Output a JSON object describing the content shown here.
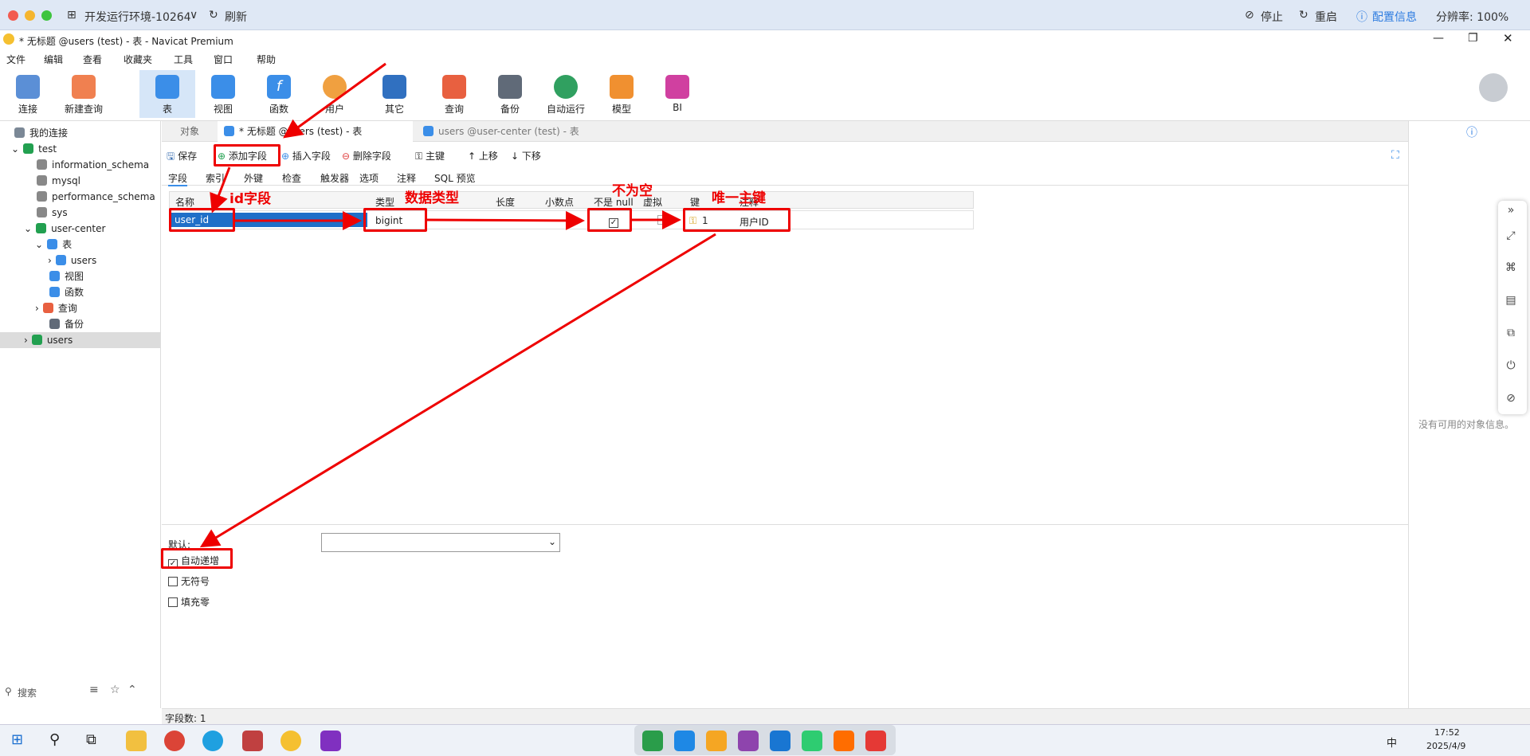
{
  "remote": {
    "env": "开发运行环境-10264",
    "refresh": "刷新",
    "stop": "停止",
    "restart": "重启",
    "config": "配置信息",
    "resolution": "分辨率: 100%"
  },
  "window": {
    "title": "* 无标题 @users (test) - 表 - Navicat Premium"
  },
  "menu": [
    "文件",
    "编辑",
    "查看",
    "收藏夹",
    "工具",
    "窗口",
    "帮助"
  ],
  "toolbar": [
    {
      "label": "连接",
      "color": "#5b8fd6"
    },
    {
      "label": "新建查询",
      "color": "#f08050"
    },
    {
      "label": "表",
      "color": "#3b8ee8"
    },
    {
      "label": "视图",
      "color": "#3b8ee8"
    },
    {
      "label": "函数",
      "color": "#3b8ee8"
    },
    {
      "label": "用户",
      "color": "#f0a040"
    },
    {
      "label": "其它",
      "color": "#3070c0"
    },
    {
      "label": "查询",
      "color": "#e86040"
    },
    {
      "label": "备份",
      "color": "#606a78"
    },
    {
      "label": "自动运行",
      "color": "#30a060"
    },
    {
      "label": "模型",
      "color": "#f09030"
    },
    {
      "label": "BI",
      "color": "#d040a0"
    }
  ],
  "sidebar": {
    "header": "我的连接",
    "items": [
      {
        "label": "test",
        "color": "#22a050"
      },
      {
        "label": "information_schema",
        "color": "#888"
      },
      {
        "label": "mysql",
        "color": "#888"
      },
      {
        "label": "performance_schema",
        "color": "#888"
      },
      {
        "label": "sys",
        "color": "#888"
      },
      {
        "label": "user-center",
        "color": "#22a050"
      },
      {
        "label": "表",
        "color": "#3b8ee8"
      },
      {
        "label": "users",
        "color": "#3b8ee8"
      },
      {
        "label": "视图",
        "color": "#3b8ee8"
      },
      {
        "label": "函数",
        "color": "#3b8ee8"
      },
      {
        "label": "查询",
        "color": "#e86040"
      },
      {
        "label": "备份",
        "color": "#606a78"
      },
      {
        "label": "users",
        "color": "#22a050"
      }
    ],
    "search_placeholder": "搜索"
  },
  "tabs": {
    "objects": "对象",
    "active": "* 无标题 @users (test) - 表",
    "other": "users @user-center (test) - 表"
  },
  "design_toolbar": {
    "save": "保存",
    "add_field": "添加字段",
    "insert_field": "插入字段",
    "delete_field": "删除字段",
    "primary_key": "主键",
    "move_up": "上移",
    "move_down": "下移"
  },
  "subtabs": [
    "字段",
    "索引",
    "外键",
    "检查",
    "触发器",
    "选项",
    "注释",
    "SQL 预览"
  ],
  "columns": [
    "名称",
    "类型",
    "长度",
    "小数点",
    "不是 null",
    "虚拟",
    "键",
    "注释"
  ],
  "rows": [
    {
      "name": "user_id",
      "type": "bigint",
      "not_null": true,
      "key": "1",
      "comment": "用户ID"
    }
  ],
  "annotations": {
    "id_field": "id字段",
    "data_type": "数据类型",
    "not_null": "不为空",
    "primary_key": "唯一主键"
  },
  "bottom": {
    "default_label": "默认:",
    "auto_increment": "自动递增",
    "unsigned": "无符号",
    "zerofill": "填充零"
  },
  "right_panel": {
    "empty": "没有可用的对象信息。"
  },
  "status": {
    "field_count": "字段数: 1"
  },
  "taskbar": {
    "time": "17:52",
    "date": "2025/4/9",
    "ime": "中"
  }
}
